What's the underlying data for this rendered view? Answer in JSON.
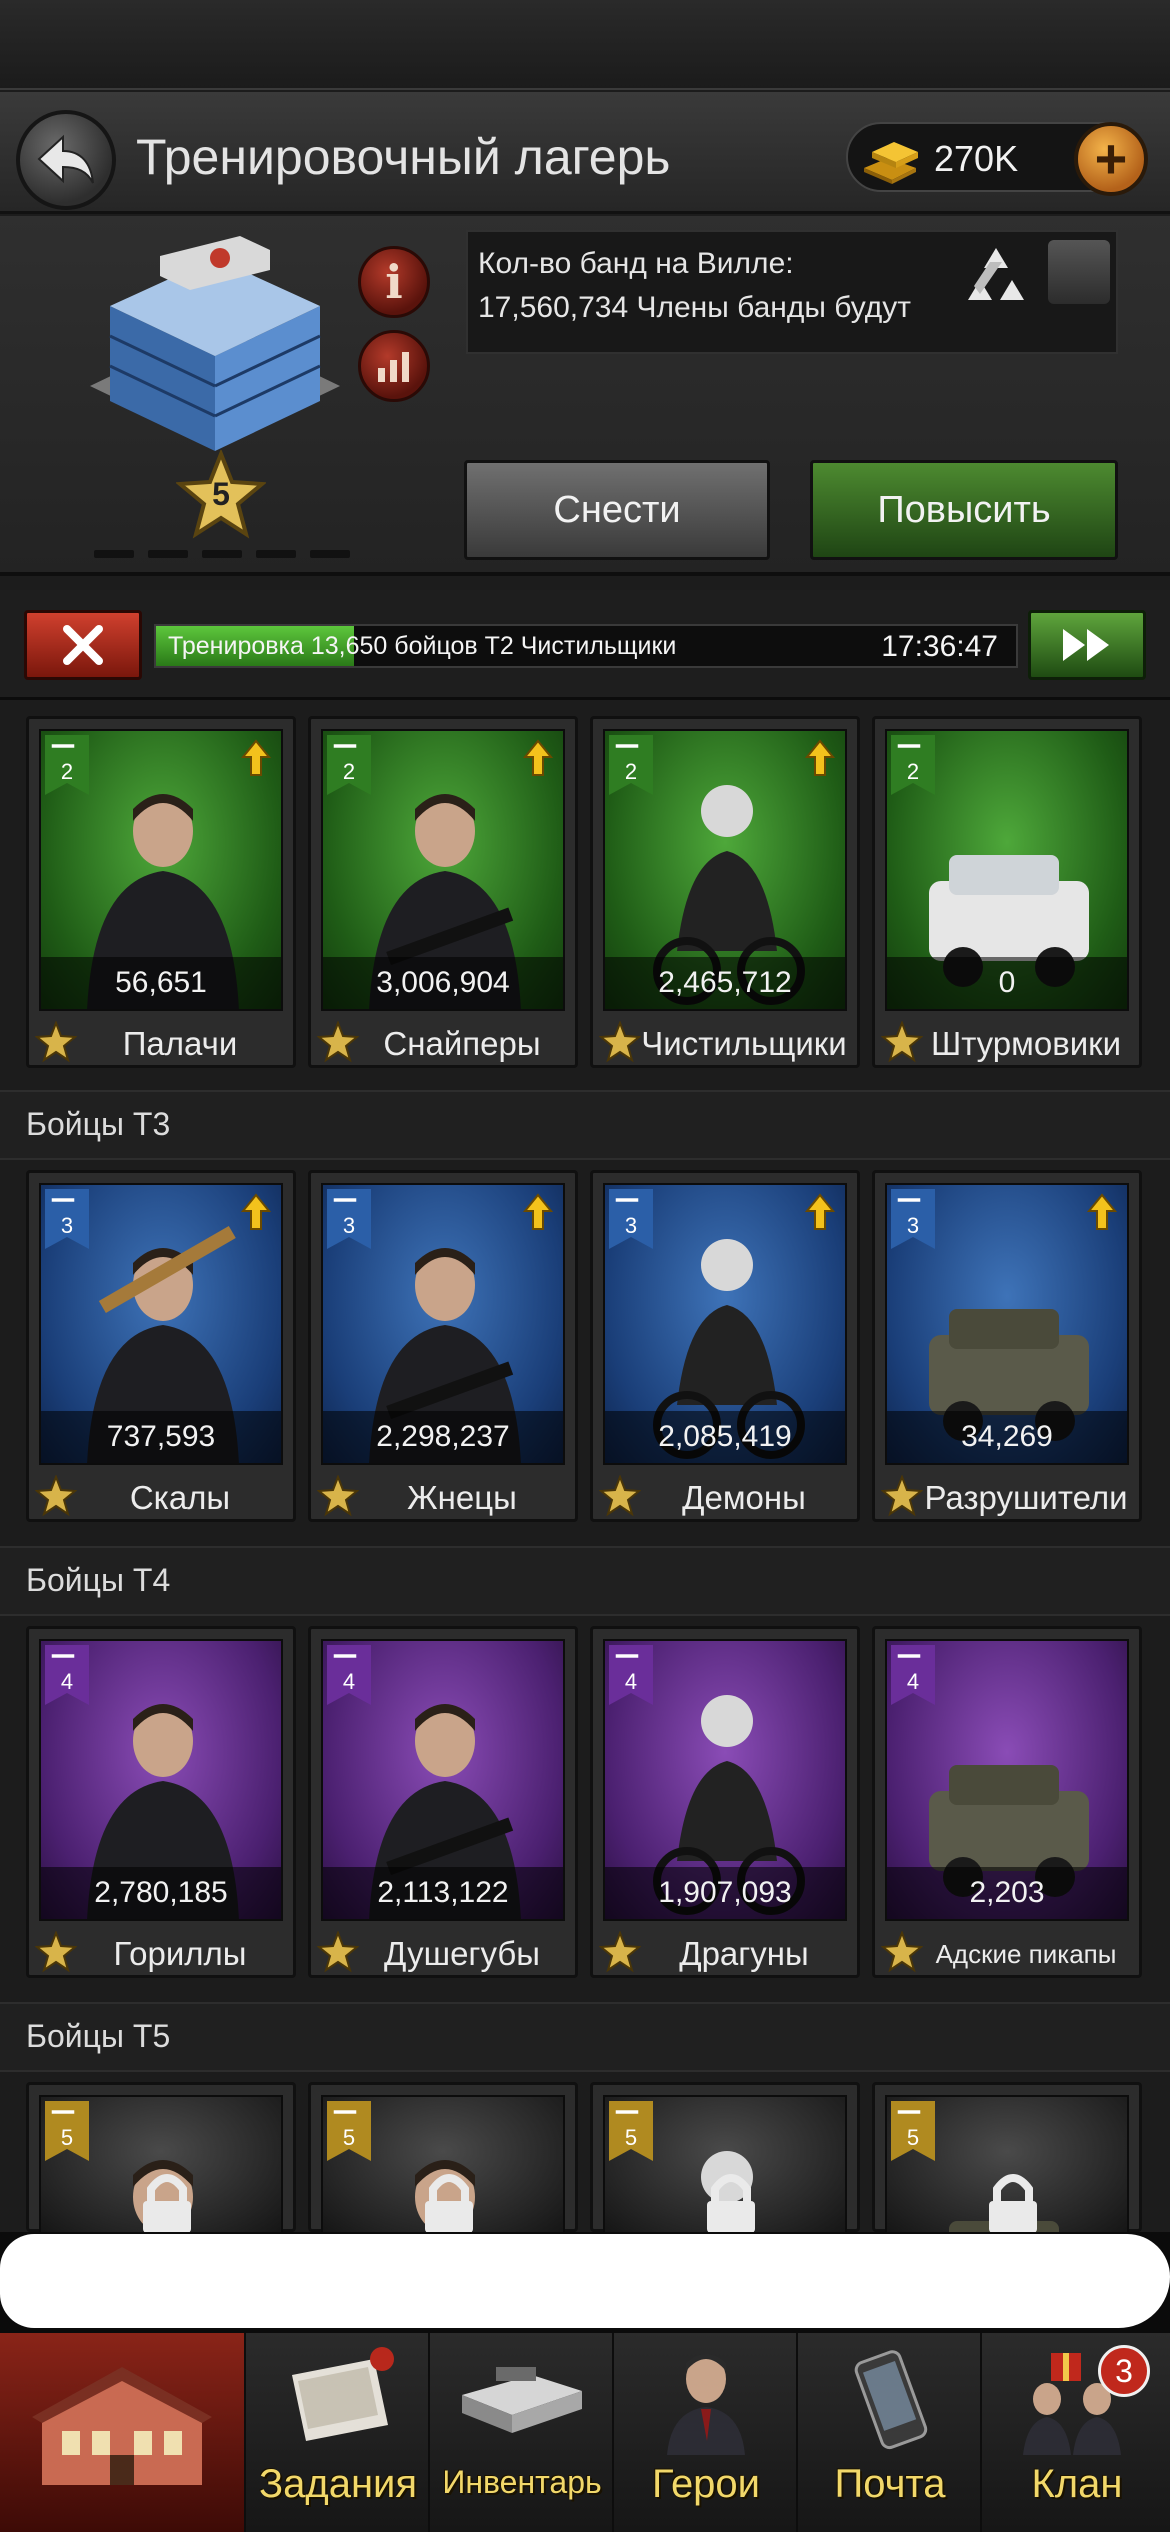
{
  "header": {
    "title": "Тренировочный лагерь",
    "gold": "270K"
  },
  "building": {
    "level": "5",
    "info_text": "Кол-во банд на Вилле: 17,560,734 Члены банды будут",
    "demolish_label": "Снести",
    "upgrade_label": "Повысить"
  },
  "training": {
    "text": "Тренировка 13,650 бойцов T2 Чистильщики",
    "time": "17:36:47",
    "progress": 0.23
  },
  "colors": {
    "t2": "#2f7d22",
    "t3": "#1f4a8c",
    "t4": "#5a2a82",
    "t5": "#3a3a3a",
    "gold_text": "#f2d86a"
  },
  "sections": [
    {
      "label": "",
      "tier": "2",
      "units": [
        {
          "name": "Палачи",
          "count": "56,651",
          "icon": "knife-icon",
          "upgrade": true
        },
        {
          "name": "Снайперы",
          "count": "3,006,904",
          "icon": "rifle-icon",
          "upgrade": true
        },
        {
          "name": "Чистильщики",
          "count": "2,465,712",
          "icon": "motorcycle-icon",
          "upgrade": true
        },
        {
          "name": "Штурмовики",
          "count": "0",
          "icon": "truck-icon",
          "upgrade": false
        }
      ]
    },
    {
      "label": "Бойцы T3",
      "tier": "3",
      "units": [
        {
          "name": "Скалы",
          "count": "737,593",
          "icon": "knife-icon",
          "upgrade": true
        },
        {
          "name": "Жнецы",
          "count": "2,298,237",
          "icon": "rifle-icon",
          "upgrade": true
        },
        {
          "name": "Демоны",
          "count": "2,085,419",
          "icon": "motorcycle-icon",
          "upgrade": true
        },
        {
          "name": "Разрушители",
          "count": "34,269",
          "icon": "truck-icon",
          "upgrade": true
        }
      ]
    },
    {
      "label": "Бойцы T4",
      "tier": "4",
      "units": [
        {
          "name": "Гориллы",
          "count": "2,780,185",
          "icon": "knife-icon",
          "upgrade": false
        },
        {
          "name": "Душегубы",
          "count": "2,113,122",
          "icon": "rifle-icon",
          "upgrade": false
        },
        {
          "name": "Драгуны",
          "count": "1,907,093",
          "icon": "motorcycle-icon",
          "upgrade": false
        },
        {
          "name": "Адские пикапы",
          "count": "2,203",
          "icon": "truck-icon",
          "upgrade": false
        }
      ]
    },
    {
      "label": "Бойцы T5",
      "tier": "5",
      "units": [
        {
          "icon": "knife-icon",
          "locked": true
        },
        {
          "icon": "rifle-icon",
          "locked": true
        },
        {
          "icon": "motorcycle-icon",
          "locked": true
        },
        {
          "icon": "truck-icon",
          "locked": true
        }
      ]
    }
  ],
  "nav": {
    "items": [
      {
        "label": "",
        "icon": "mansion-icon"
      },
      {
        "label": "Задания",
        "icon": "tasks-icon"
      },
      {
        "label": "Инвентарь",
        "icon": "briefcase-icon"
      },
      {
        "label": "Герои",
        "icon": "hero-icon"
      },
      {
        "label": "Почта",
        "icon": "phone-icon"
      },
      {
        "label": "Клан",
        "icon": "clan-icon",
        "badge": "3"
      }
    ]
  }
}
